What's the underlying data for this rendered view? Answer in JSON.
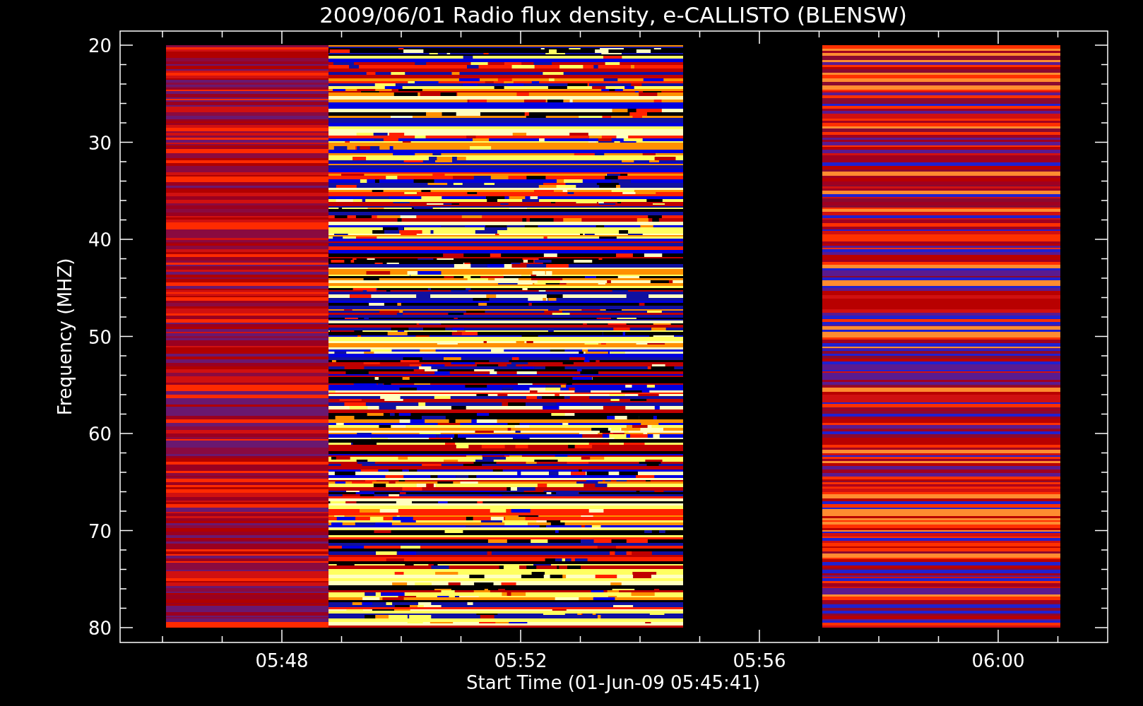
{
  "plot": {
    "title": "2009/06/01  Radio flux density, e-CALLISTO (BLENSW)",
    "xlabel": "Start Time (01-Jun-09 05:45:41)",
    "ylabel": "Frequency (MHZ)",
    "y_tick_labels": [
      "20",
      "30",
      "40",
      "50",
      "60",
      "70",
      "80"
    ],
    "x_tick_labels": [
      "05:48",
      "05:52",
      "05:56",
      "06:00"
    ]
  }
}
